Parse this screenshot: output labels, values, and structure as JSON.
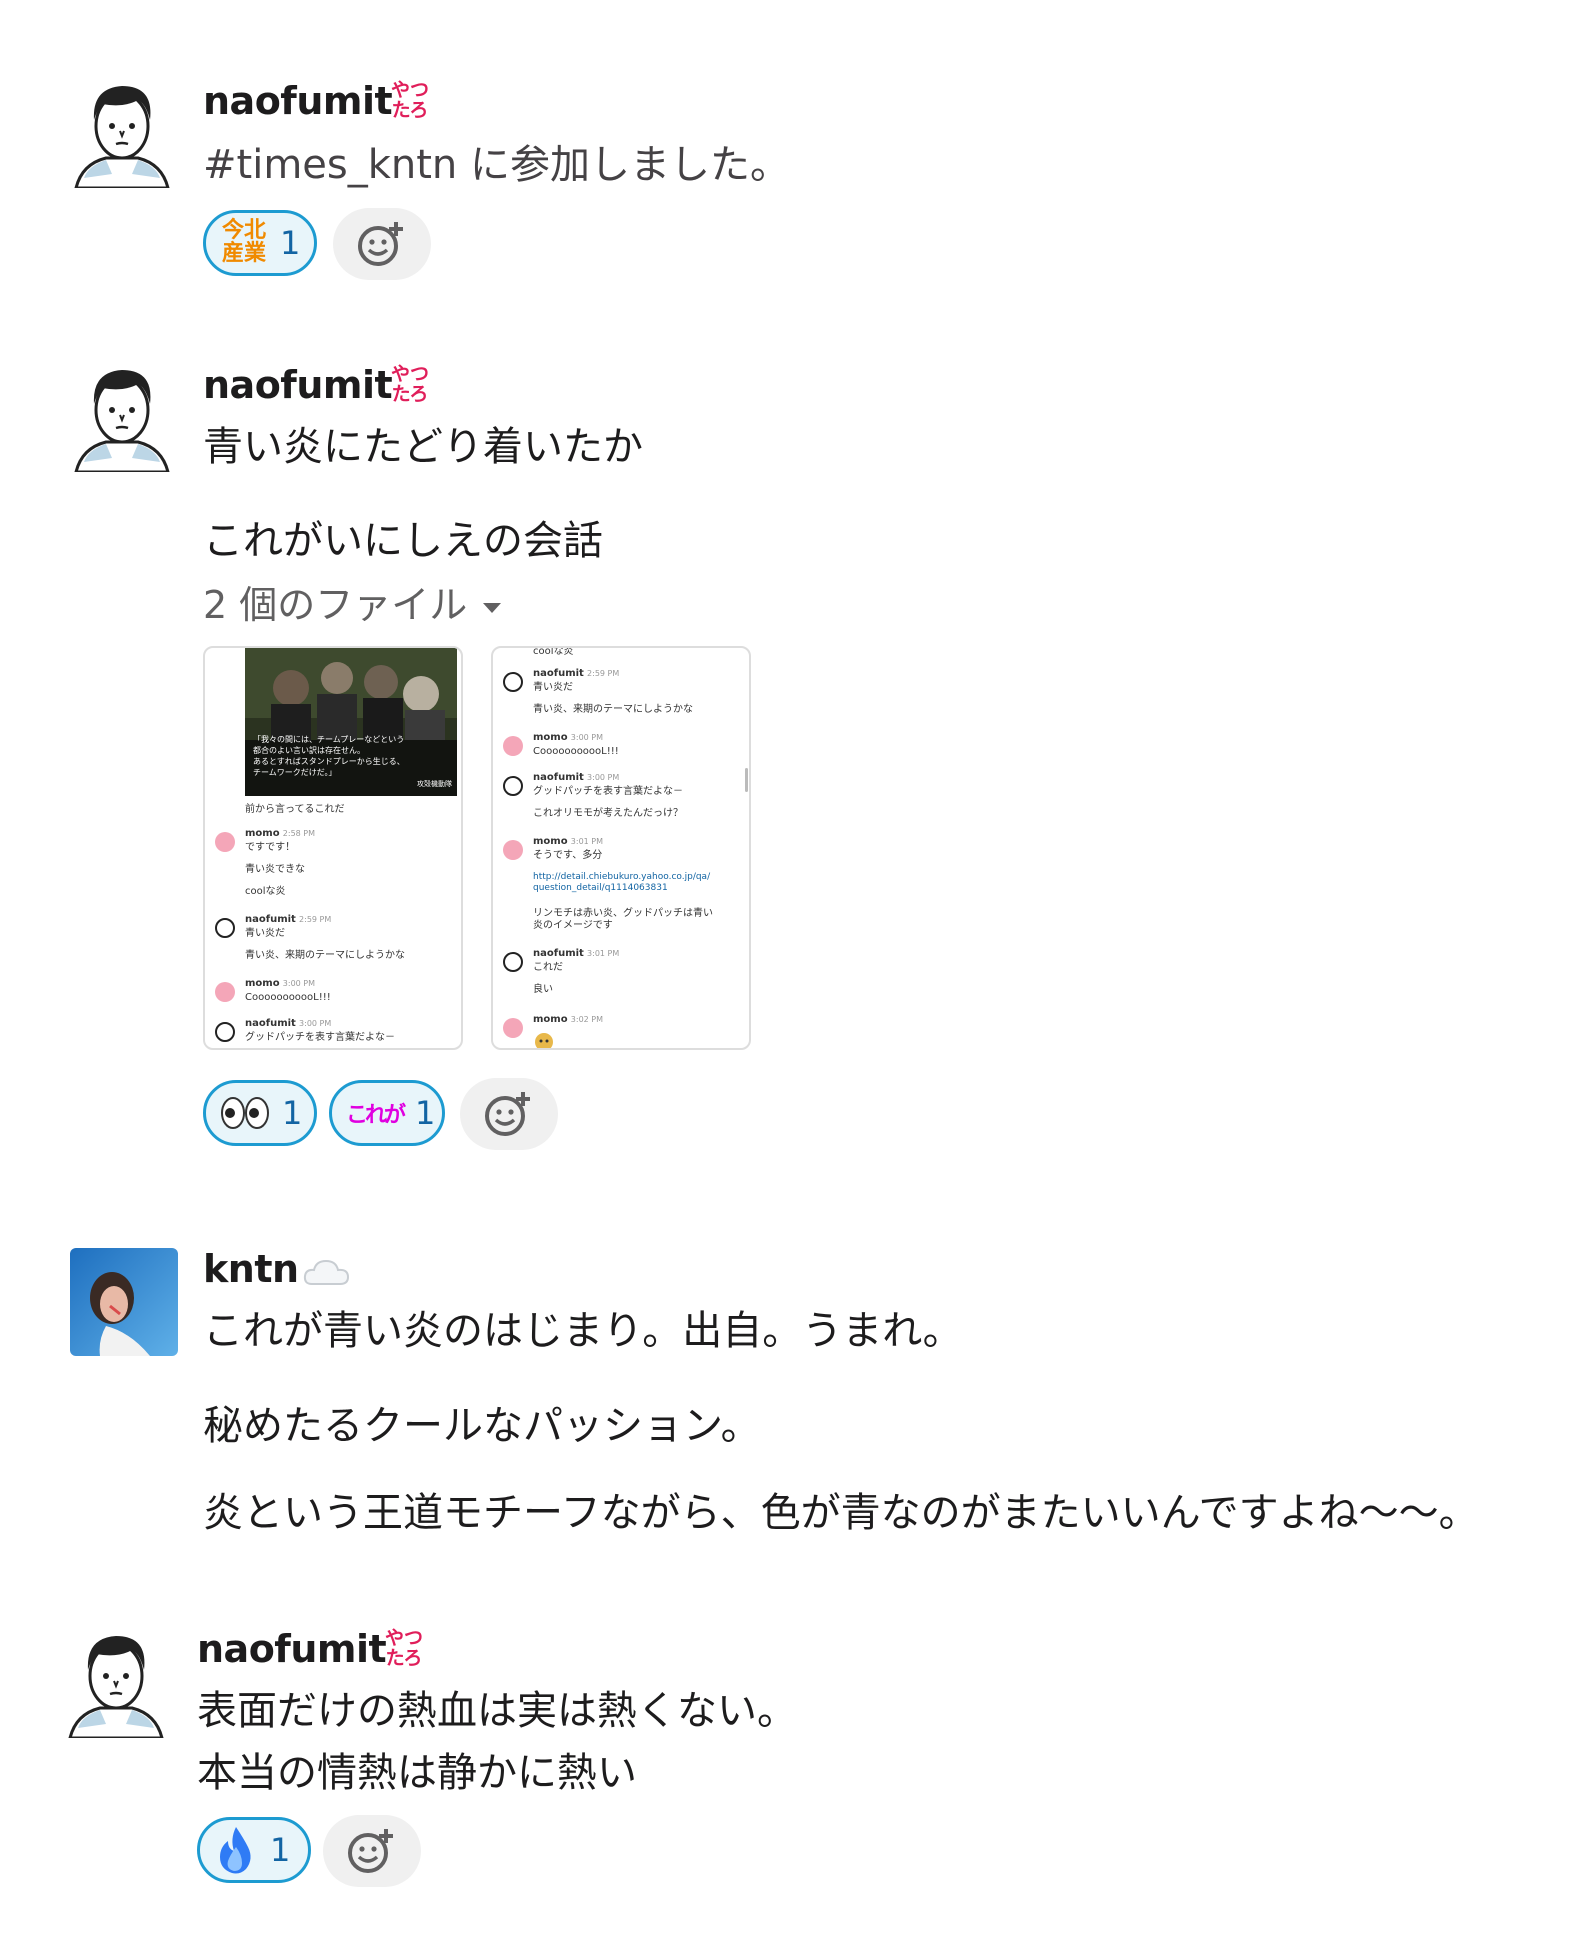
{
  "messages": [
    {
      "user": "naofumit",
      "status_emoji_lines": [
        "やつ",
        "たろ"
      ],
      "lines": [
        "#times_kntn に参加しました。"
      ],
      "reactions": [
        {
          "emoji": "今北産業",
          "emoji_lines": [
            "今北",
            "産業"
          ],
          "count": "1"
        }
      ]
    },
    {
      "user": "naofumit",
      "status_emoji_lines": [
        "やつ",
        "たろ"
      ],
      "lines": [
        "青い炎にたどり着いたか",
        "これがいにしえの会話"
      ],
      "files_toggle": "2 個のファイル",
      "reactions": [
        {
          "emoji": "eyes",
          "count": "1"
        },
        {
          "emoji": "これが",
          "count": "1"
        }
      ]
    },
    {
      "user": "kntn",
      "status_emoji": "cloud",
      "lines": [
        "これが青い炎のはじまり。出自。うまれ。",
        "秘めたるクールなパッション。",
        "炎という王道モチーフながら、色が青なのがまたいいんですよね〜〜。"
      ]
    },
    {
      "user": "naofumit",
      "status_emoji_lines": [
        "やつ",
        "たろ"
      ],
      "lines": [
        "表面だけの熱血は実は熱くない。",
        "本当の情熱は静かに熱い"
      ],
      "reactions": [
        {
          "emoji": "blue-fire",
          "count": "1"
        }
      ]
    }
  ],
  "file1": {
    "image_caption_lines": [
      "「我々の間には、チームプレーなどという",
      "都合のよい言い訳は存在せん。",
      "あるとすればスタンドプレーから生じる、",
      "チームワークだけだ。」"
    ],
    "image_credit": "攻殻機動隊",
    "pre_line": "前から言ってるこれだ",
    "items": [
      {
        "user": "momo",
        "time": "2:58 PM",
        "lines": [
          "ですです！",
          "青い炎できな",
          "coolな炎"
        ]
      },
      {
        "user": "naofumit",
        "time": "2:59 PM",
        "lines": [
          "青い炎だ",
          "青い炎、来期のテーマにしようかな"
        ]
      },
      {
        "user": "momo",
        "time": "3:00 PM",
        "lines": [
          "CooooooooooL!!!"
        ]
      },
      {
        "user": "naofumit",
        "time": "3:00 PM",
        "lines": [
          "グッドパッチを表す言葉だよな－"
        ]
      }
    ]
  },
  "file2": {
    "top_line": "coolな炎",
    "items": [
      {
        "user": "naofumit",
        "time": "2:59 PM",
        "lines": [
          "青い炎だ",
          "青い炎、来期のテーマにしようかな"
        ]
      },
      {
        "user": "momo",
        "time": "3:00 PM",
        "lines": [
          "CooooooooooL!!!"
        ]
      },
      {
        "user": "naofumit",
        "time": "3:00 PM",
        "lines": [
          "グッドパッチを表す言葉だよな－",
          "これオリモモが考えたんだっけ？"
        ]
      },
      {
        "user": "momo",
        "time": "3:01 PM",
        "lines": [
          "そうです、多分"
        ],
        "link_lines": [
          "http://detail.chiebukuro.yahoo.co.jp/qa/",
          "question_detail/q1114063831"
        ],
        "after_lines": [
          "リンモチは赤い炎、グッドパッチは青い",
          "炎のイメージです"
        ]
      },
      {
        "user": "naofumit",
        "time": "3:01 PM",
        "lines": [
          "これだ",
          "良い"
        ]
      },
      {
        "user": "momo",
        "time": "3:02 PM",
        "lines": []
      }
    ]
  },
  "colors": {
    "reaction_border": "#1d9bd1",
    "reaction_bg": "#e8f5fa",
    "reaction_count": "#1264a3",
    "status_emoji": "#e01e5a",
    "kore_ga": "#e000e0",
    "kon_hoku": "#f08a00"
  }
}
